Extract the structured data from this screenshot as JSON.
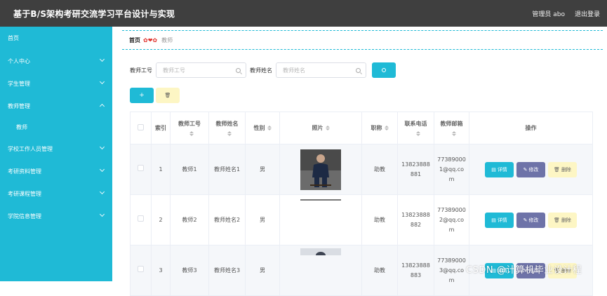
{
  "app": {
    "title": "基于B/S架构考研交流学习平台设计与实现"
  },
  "header": {
    "user_label": "管理员 abo",
    "logout_label": "退出登录"
  },
  "sidebar": {
    "items": [
      {
        "label": "首页",
        "expandable": false
      },
      {
        "label": "个人中心",
        "expandable": true
      },
      {
        "label": "学生管理",
        "expandable": true
      },
      {
        "label": "教师管理",
        "expandable": true,
        "expanded": true
      },
      {
        "label": "教师",
        "sub": true
      },
      {
        "label": "学校工作人员管理",
        "expandable": true
      },
      {
        "label": "考研资料管理",
        "expandable": true
      },
      {
        "label": "考研课程管理",
        "expandable": true
      },
      {
        "label": "学院信息管理",
        "expandable": true
      }
    ]
  },
  "breadcrumb": {
    "home": "首页",
    "separator": "✿❤✿",
    "current": "教师"
  },
  "search": {
    "field1_label": "教师工号",
    "field1_placeholder": "教师工号",
    "field2_label": "教师姓名",
    "field2_placeholder": "教师姓名"
  },
  "toolbar": {
    "add_label": "+",
    "delete_label": "🗑"
  },
  "table": {
    "headers": {
      "index": "索引",
      "teacher_no": "教师工号",
      "teacher_name": "教师姓名",
      "gender": "性别",
      "photo": "照片",
      "title": "职称",
      "phone": "联系电话",
      "email": "教师邮箱",
      "actions": "操作"
    },
    "rows": [
      {
        "index": "1",
        "teacher_no": "教师1",
        "teacher_name": "教师姓名1",
        "gender": "男",
        "title": "助教",
        "phone_l1": "13823888",
        "phone_l2": "881",
        "email_l1": "77389000",
        "email_l2": "1@qq.co",
        "email_l3": "m"
      },
      {
        "index": "2",
        "teacher_no": "教师2",
        "teacher_name": "教师姓名2",
        "gender": "男",
        "title": "助教",
        "phone_l1": "13823888",
        "phone_l2": "882",
        "email_l1": "77389000",
        "email_l2": "2@qq.co",
        "email_l3": "m"
      },
      {
        "index": "3",
        "teacher_no": "教师3",
        "teacher_name": "教师姓名3",
        "gender": "男",
        "title": "助教",
        "phone_l1": "13823888",
        "phone_l2": "883",
        "email_l1": "77389000",
        "email_l2": "3@qq.co",
        "email_l3": "m"
      }
    ],
    "row_actions": {
      "detail": "详情",
      "edit": "修改",
      "delete": "删除"
    }
  },
  "watermark": "CSDN @计算机毕业设计程",
  "colors": {
    "accent": "#1fbad6",
    "topbar": "#3f3f3f",
    "edit": "#6e73a8",
    "delete_bg": "#fdf6c4"
  },
  "icons": [
    "search-icon",
    "plus-icon",
    "trash-icon",
    "chevron-down-icon",
    "chevron-up-icon",
    "detail-icon",
    "edit-icon",
    "sort-icon"
  ]
}
